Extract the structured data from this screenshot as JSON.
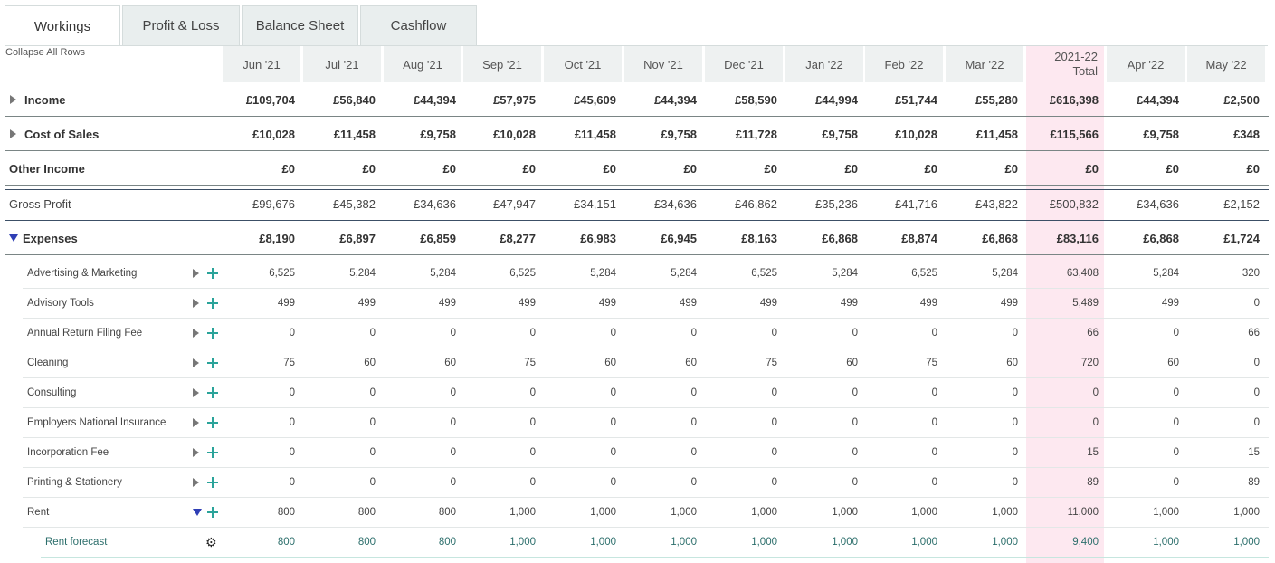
{
  "tabs": [
    {
      "label": "Workings",
      "active": true
    },
    {
      "label": "Profit & Loss",
      "active": false
    },
    {
      "label": "Balance Sheet",
      "active": false
    },
    {
      "label": "Cashflow",
      "active": false
    }
  ],
  "collapse_all_label": "Collapse All Rows",
  "columns": [
    "Jun '21",
    "Jul '21",
    "Aug '21",
    "Sep '21",
    "Oct '21",
    "Nov '21",
    "Dec '21",
    "Jan '22",
    "Feb '22",
    "Mar '22",
    "2021-22",
    "Apr '22",
    "May '22"
  ],
  "total_column_sub": "Total",
  "colors": {
    "accent_teal": "#2aa39a",
    "total_highlight": "#fde8f0",
    "expand_blue": "#2f3fb5",
    "forecast_text": "#2d6f6c"
  },
  "rows": [
    {
      "label": "Income",
      "kind": "summary",
      "toggle": "collapsed",
      "values": [
        "£109,704",
        "£56,840",
        "£44,394",
        "£57,975",
        "£45,609",
        "£44,394",
        "£58,590",
        "£44,994",
        "£51,744",
        "£55,280",
        "£616,398",
        "£44,394",
        "£2,500"
      ]
    },
    {
      "label": "Cost of Sales",
      "kind": "summary",
      "toggle": "collapsed",
      "values": [
        "£10,028",
        "£11,458",
        "£9,758",
        "£10,028",
        "£11,458",
        "£9,758",
        "£11,728",
        "£9,758",
        "£10,028",
        "£11,458",
        "£115,566",
        "£9,758",
        "£348"
      ]
    },
    {
      "label": "Other Income",
      "kind": "summary",
      "toggle": "none",
      "values": [
        "£0",
        "£0",
        "£0",
        "£0",
        "£0",
        "£0",
        "£0",
        "£0",
        "£0",
        "£0",
        "£0",
        "£0",
        "£0"
      ]
    },
    {
      "label": "Gross Profit",
      "kind": "gross",
      "toggle": "none",
      "values": [
        "£99,676",
        "£45,382",
        "£34,636",
        "£47,947",
        "£34,151",
        "£34,636",
        "£46,862",
        "£35,236",
        "£41,716",
        "£43,822",
        "£500,832",
        "£34,636",
        "£2,152"
      ]
    },
    {
      "label": "Expenses",
      "kind": "summary",
      "toggle": "expanded",
      "values": [
        "£8,190",
        "£6,897",
        "£6,859",
        "£8,277",
        "£6,983",
        "£6,945",
        "£8,163",
        "£6,868",
        "£8,874",
        "£6,868",
        "£83,116",
        "£6,868",
        "£1,724"
      ]
    },
    {
      "label": "Advertising & Marketing",
      "kind": "item",
      "toggle": "collapsed",
      "values": [
        "6,525",
        "5,284",
        "5,284",
        "6,525",
        "5,284",
        "5,284",
        "6,525",
        "5,284",
        "6,525",
        "5,284",
        "63,408",
        "5,284",
        "320"
      ]
    },
    {
      "label": "Advisory Tools",
      "kind": "item",
      "toggle": "collapsed",
      "values": [
        "499",
        "499",
        "499",
        "499",
        "499",
        "499",
        "499",
        "499",
        "499",
        "499",
        "5,489",
        "499",
        "0"
      ]
    },
    {
      "label": "Annual Return Filing Fee",
      "kind": "item",
      "toggle": "collapsed",
      "values": [
        "0",
        "0",
        "0",
        "0",
        "0",
        "0",
        "0",
        "0",
        "0",
        "0",
        "66",
        "0",
        "66"
      ]
    },
    {
      "label": "Cleaning",
      "kind": "item",
      "toggle": "collapsed",
      "values": [
        "75",
        "60",
        "60",
        "75",
        "60",
        "60",
        "75",
        "60",
        "75",
        "60",
        "720",
        "60",
        "0"
      ]
    },
    {
      "label": "Consulting",
      "kind": "item",
      "toggle": "collapsed",
      "values": [
        "0",
        "0",
        "0",
        "0",
        "0",
        "0",
        "0",
        "0",
        "0",
        "0",
        "0",
        "0",
        "0"
      ]
    },
    {
      "label": "Employers National Insurance",
      "kind": "item",
      "toggle": "collapsed",
      "values": [
        "0",
        "0",
        "0",
        "0",
        "0",
        "0",
        "0",
        "0",
        "0",
        "0",
        "0",
        "0",
        "0"
      ]
    },
    {
      "label": "Incorporation Fee",
      "kind": "item",
      "toggle": "collapsed",
      "values": [
        "0",
        "0",
        "0",
        "0",
        "0",
        "0",
        "0",
        "0",
        "0",
        "0",
        "15",
        "0",
        "15"
      ]
    },
    {
      "label": "Printing & Stationery",
      "kind": "item",
      "toggle": "collapsed",
      "values": [
        "0",
        "0",
        "0",
        "0",
        "0",
        "0",
        "0",
        "0",
        "0",
        "0",
        "89",
        "0",
        "89"
      ]
    },
    {
      "label": "Rent",
      "kind": "item",
      "toggle": "expanded",
      "values": [
        "800",
        "800",
        "800",
        "1,000",
        "1,000",
        "1,000",
        "1,000",
        "1,000",
        "1,000",
        "1,000",
        "11,000",
        "1,000",
        "1,000"
      ]
    },
    {
      "label": "Rent forecast",
      "kind": "forecast",
      "toggle": "gear",
      "values": [
        "800",
        "800",
        "800",
        "1,000",
        "1,000",
        "1,000",
        "1,000",
        "1,000",
        "1,000",
        "1,000",
        "9,400",
        "1,000",
        "1,000"
      ]
    }
  ]
}
